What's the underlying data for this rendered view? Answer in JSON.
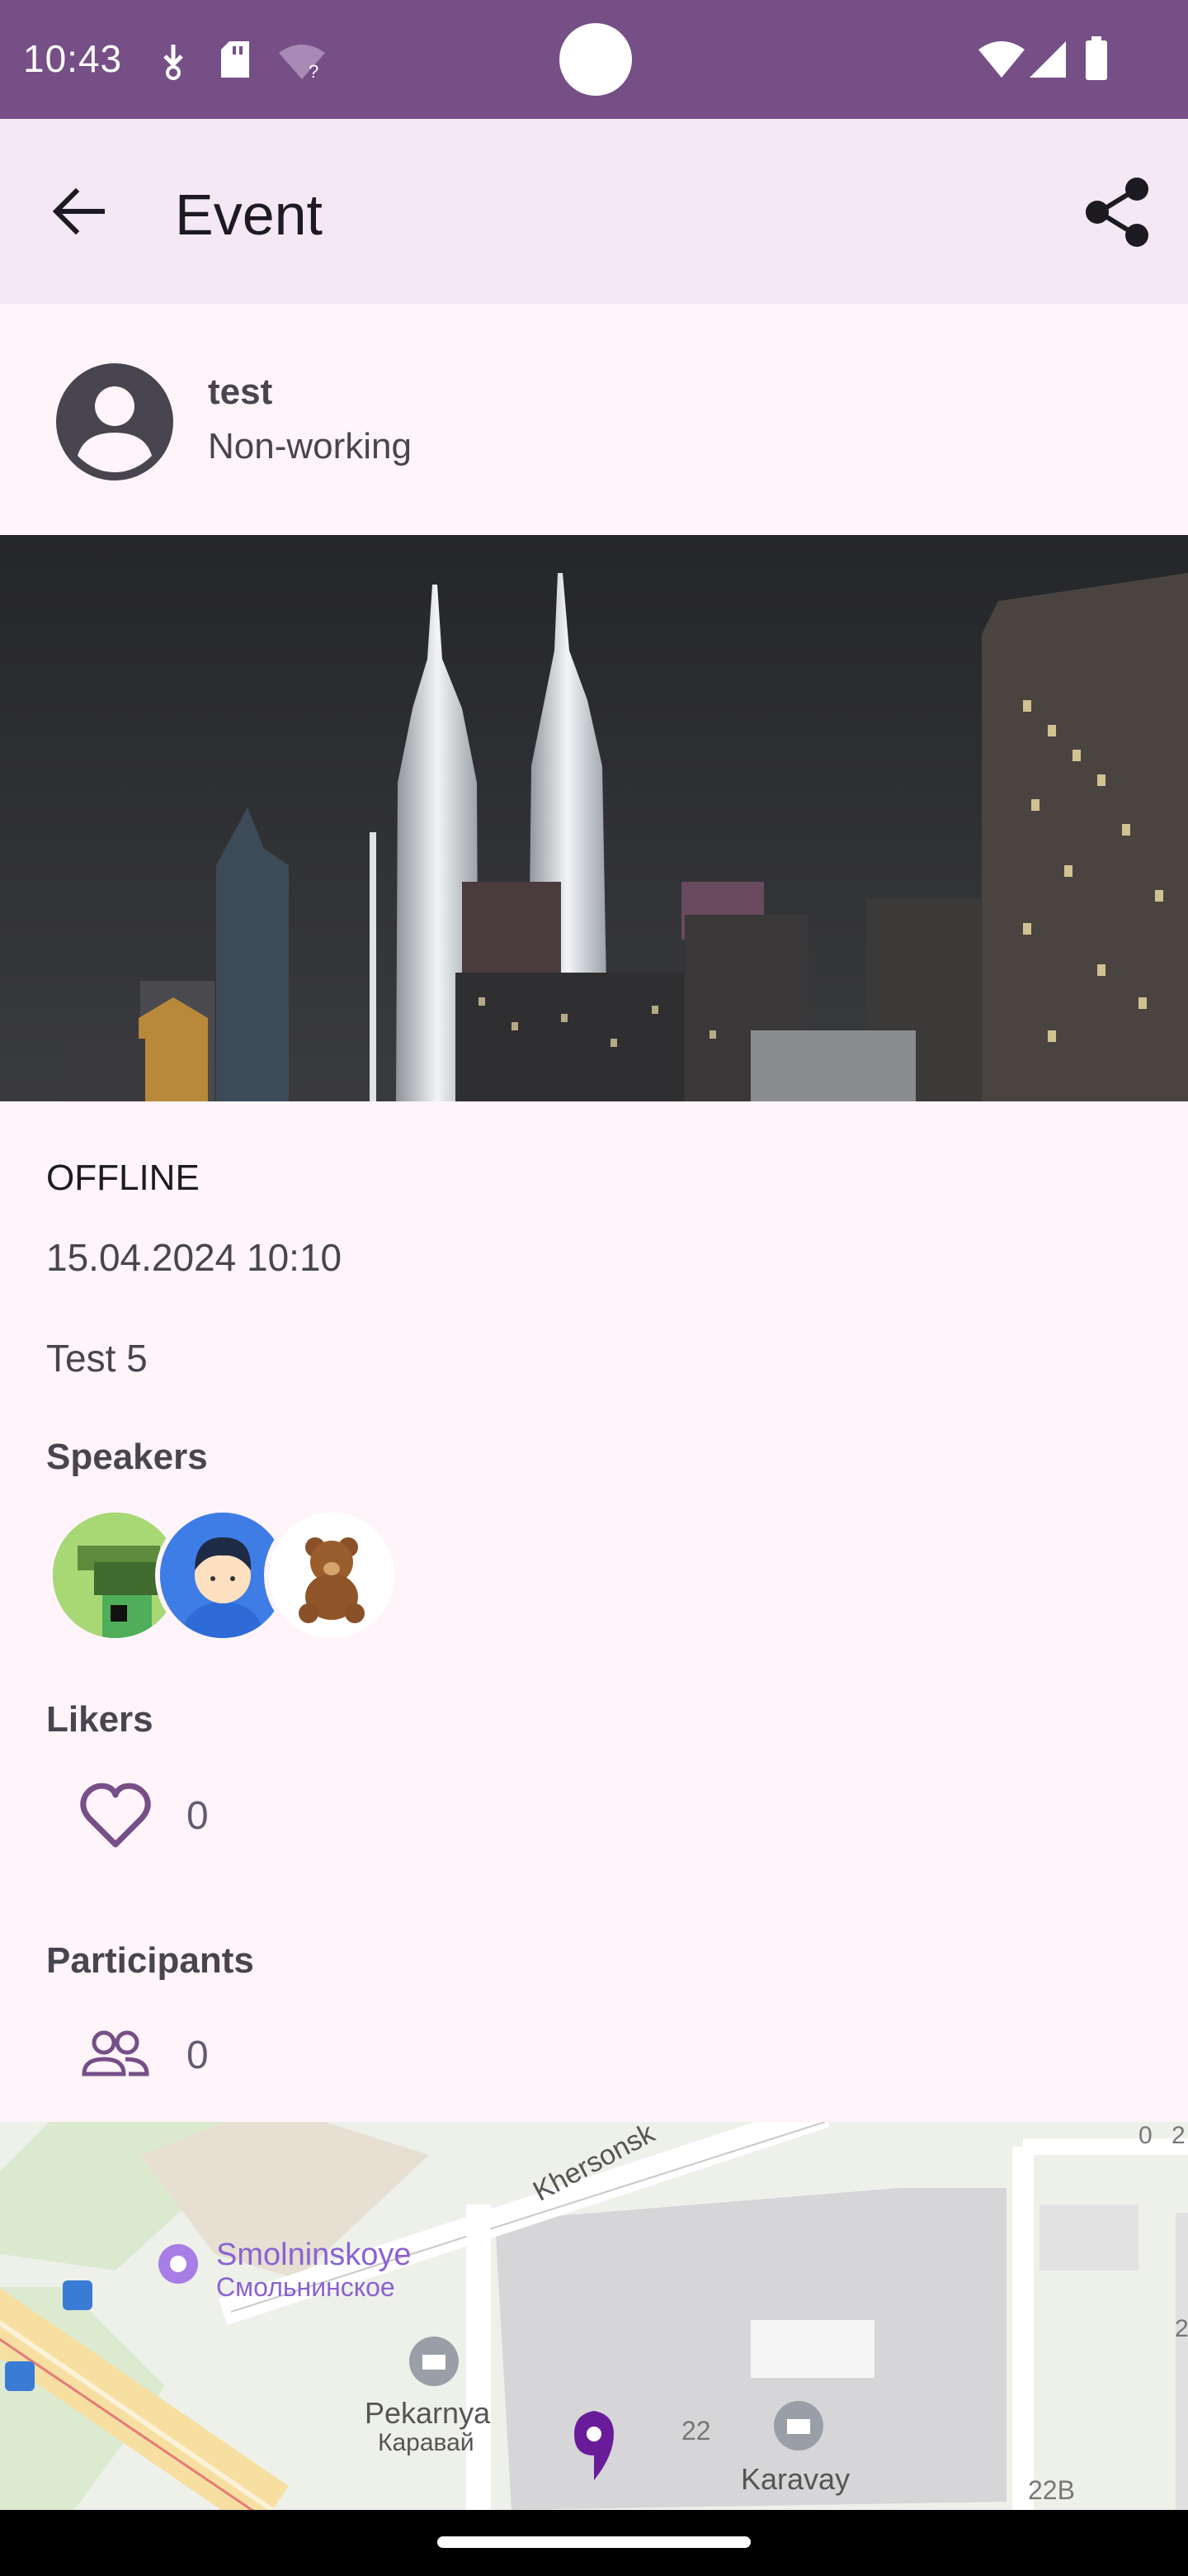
{
  "status_bar": {
    "time": "10:43",
    "left_icons": [
      "download-icon",
      "sd-card-icon",
      "wifi-question-icon"
    ],
    "right_icons": [
      "wifi-icon",
      "signal-icon",
      "battery-icon"
    ],
    "background": "#764f87"
  },
  "app_bar": {
    "title": "Event",
    "back_icon": "arrow-back-icon",
    "share_icon": "share-icon",
    "background": "#f3e8f3"
  },
  "author": {
    "name": "test",
    "job": "Non-working",
    "avatar_icon": "account-circle-icon"
  },
  "event": {
    "type": "OFFLINE",
    "datetime": "15.04.2024 10:10",
    "content": "Test 5"
  },
  "speakers": {
    "title": "Speakers",
    "avatars": [
      "pixel-art-avatar",
      "boy-avatar",
      "teddy-bear-avatar"
    ]
  },
  "likers": {
    "title": "Likers",
    "count": "0",
    "icon": "heart-outline-icon"
  },
  "participants": {
    "title": "Participants",
    "count": "0",
    "icon": "group-icon"
  },
  "map": {
    "labels": {
      "street": "Khersonsk",
      "smolninskoye_en": "Smolninskoye",
      "smolninskoye_ru": "Смольнинское",
      "pekarnya_en": "Pekarnya",
      "pekarnya_ru": "Каравай",
      "karavay_en": "Karavay",
      "num_22": "22",
      "num_22b": "22B",
      "num_0": "0",
      "num_2": "2",
      "num_2b": "2"
    },
    "pin_color": "#6a1b9a"
  },
  "colors": {
    "accent": "#764f87",
    "surface": "#fff4fa",
    "on_surface_variant": "#49454f"
  }
}
